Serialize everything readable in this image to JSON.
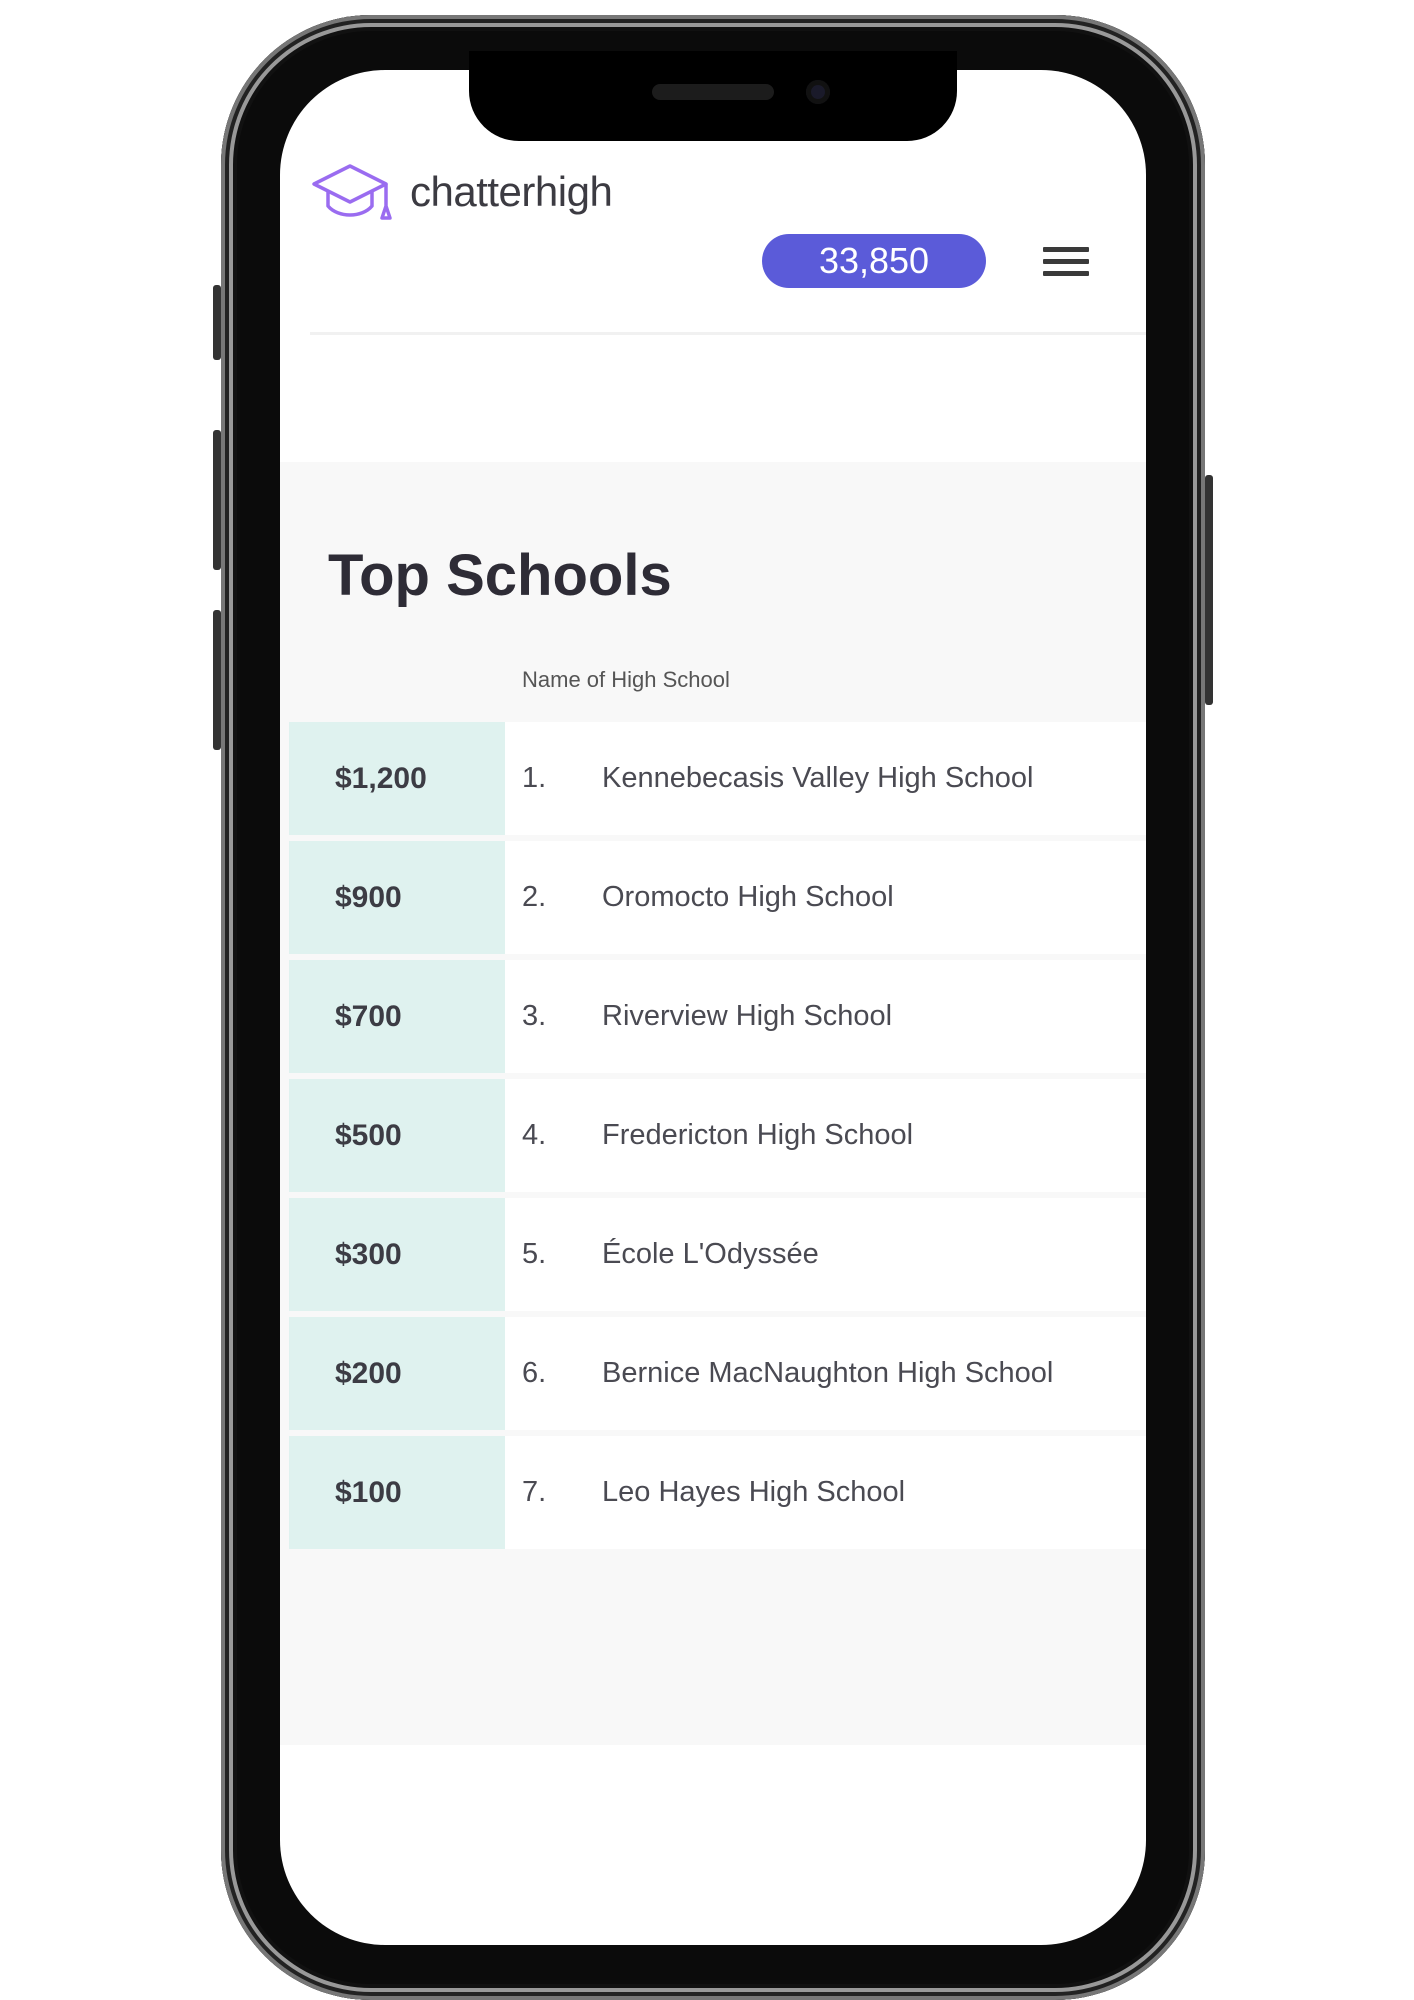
{
  "header": {
    "brand": "chatterhigh",
    "logo_icon": "graduation-cap-icon",
    "points": "33,850",
    "menu_icon": "hamburger-menu-icon",
    "accent_color": "#5b5bd9"
  },
  "main": {
    "title": "Top Schools",
    "column_header": "Name of High School",
    "rows": [
      {
        "amount": "$1,200",
        "rank": "1.",
        "school": "Kennebecasis Valley High School"
      },
      {
        "amount": "$900",
        "rank": "2.",
        "school": "Oromocto High School"
      },
      {
        "amount": "$700",
        "rank": "3.",
        "school": "Riverview High School"
      },
      {
        "amount": "$500",
        "rank": "4.",
        "school": "Fredericton High School"
      },
      {
        "amount": "$300",
        "rank": "5.",
        "school": "École L'Odyssée"
      },
      {
        "amount": "$200",
        "rank": "6.",
        "school": "Bernice MacNaughton High School"
      },
      {
        "amount": "$100",
        "rank": "7.",
        "school": "Leo Hayes High School"
      }
    ]
  }
}
